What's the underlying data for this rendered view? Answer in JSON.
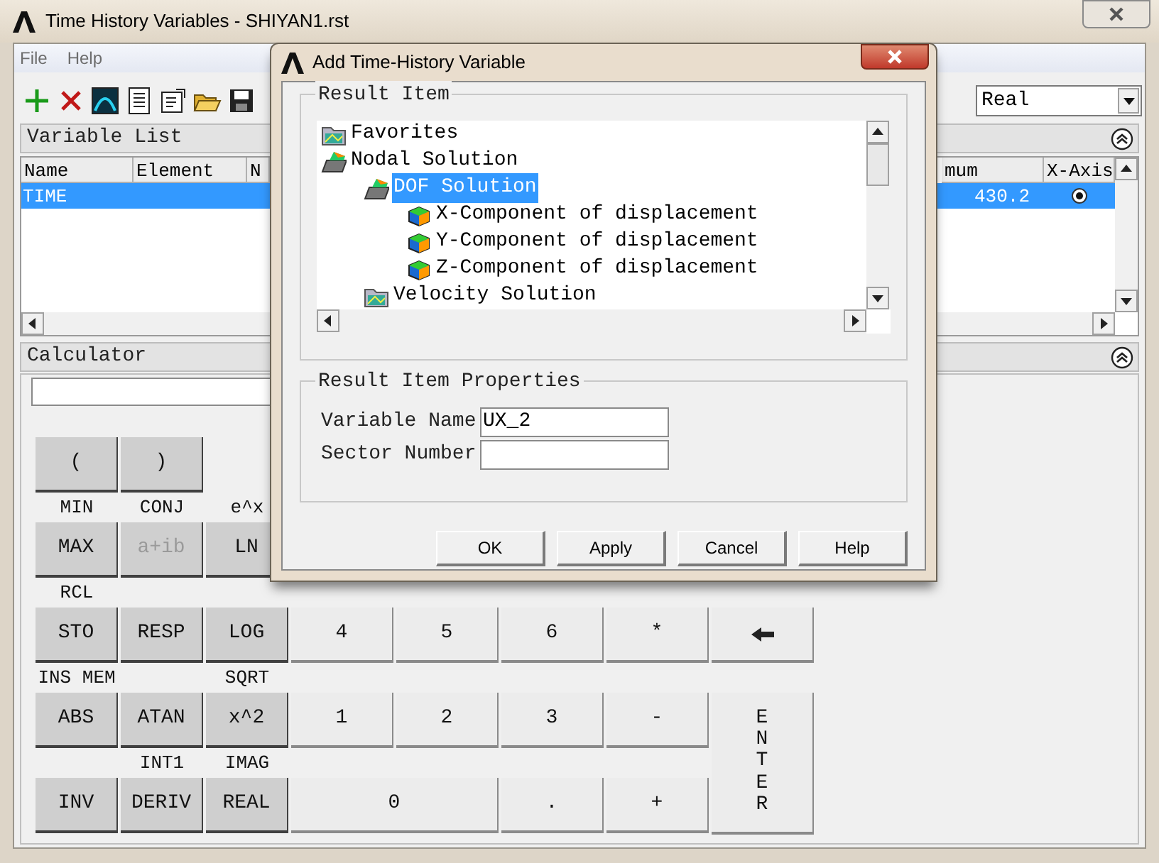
{
  "main_window": {
    "title": "Time History Variables - SHIYAN1.rst"
  },
  "menu": [
    "File",
    "Help"
  ],
  "dropdown": {
    "value": "Real"
  },
  "variable_list": {
    "title": "Variable List",
    "columns": [
      "Name",
      "Element",
      "N",
      "mum",
      "X-Axis"
    ],
    "rows": [
      {
        "name": "TIME",
        "column_4": "430.2",
        "x_axis": true,
        "selected": true
      }
    ]
  },
  "calculator": {
    "title": "Calculator",
    "rows": [
      {
        "keys": [
          {
            "label": "(",
            "kind": "function"
          },
          {
            "label": ")",
            "kind": "function"
          }
        ]
      },
      {
        "keys": [
          {
            "label": "MAX",
            "kind": "function",
            "above": "MIN"
          },
          {
            "label": "a+ib",
            "kind": "function",
            "disabled": true,
            "above": "CONJ"
          },
          {
            "label": "LN",
            "kind": "function",
            "above": "e^x"
          }
        ]
      },
      {
        "keys": [
          {
            "label": "STO",
            "kind": "function",
            "above": "RCL"
          },
          {
            "label": "RESP",
            "kind": "function"
          },
          {
            "label": "LOG",
            "kind": "function"
          },
          {
            "label": "4",
            "kind": "digit"
          },
          {
            "label": "5",
            "kind": "digit"
          },
          {
            "label": "6",
            "kind": "digit"
          },
          {
            "label": "*",
            "kind": "digit"
          },
          {
            "kind": "backspace"
          }
        ]
      },
      {
        "keys": [
          {
            "label": "ABS",
            "kind": "function",
            "above": "INS MEM"
          },
          {
            "label": "ATAN",
            "kind": "function"
          },
          {
            "label": "x^2",
            "kind": "function",
            "above": "SQRT"
          },
          {
            "label": "1",
            "kind": "digit"
          },
          {
            "label": "2",
            "kind": "digit"
          },
          {
            "label": "3",
            "kind": "digit"
          },
          {
            "label": "-",
            "kind": "digit"
          },
          {
            "label": "ENTER",
            "kind": "enter"
          }
        ]
      },
      {
        "keys": [
          {
            "label": "INV",
            "kind": "function"
          },
          {
            "label": "DERIV",
            "kind": "function",
            "above": "INT1"
          },
          {
            "label": "REAL",
            "kind": "function",
            "above": "IMAG"
          },
          {
            "label": "0",
            "kind": "wide"
          },
          {
            "label": ".",
            "kind": "digit"
          },
          {
            "label": "+",
            "kind": "digit"
          }
        ]
      }
    ]
  },
  "dialog": {
    "title": "Add Time-History Variable",
    "result_item": {
      "title": "Result Item",
      "tree": [
        {
          "label": "Favorites",
          "kind": "folder",
          "selected": false
        },
        {
          "label": "Nodal Solution",
          "kind": "open_folder",
          "selected": false,
          "children": [
            {
              "label": "DOF Solution",
              "kind": "open_folder",
              "selected": true,
              "children": [
                {
                  "label": "X-Component of displacement",
                  "kind": "item",
                  "selected": false
                },
                {
                  "label": "Y-Component of displacement",
                  "kind": "item",
                  "selected": false
                },
                {
                  "label": "Z-Component of displacement",
                  "kind": "item",
                  "selected": false
                }
              ]
            },
            {
              "label": "Velocity Solution",
              "kind": "folder",
              "selected": false
            }
          ]
        }
      ]
    },
    "properties": {
      "title": "Result Item Properties",
      "fields": [
        {
          "label": "Variable Name",
          "value": "UX_2"
        },
        {
          "label": "Sector Number"
        }
      ]
    },
    "buttons": [
      "OK",
      "Apply",
      "Cancel",
      "Help"
    ]
  }
}
